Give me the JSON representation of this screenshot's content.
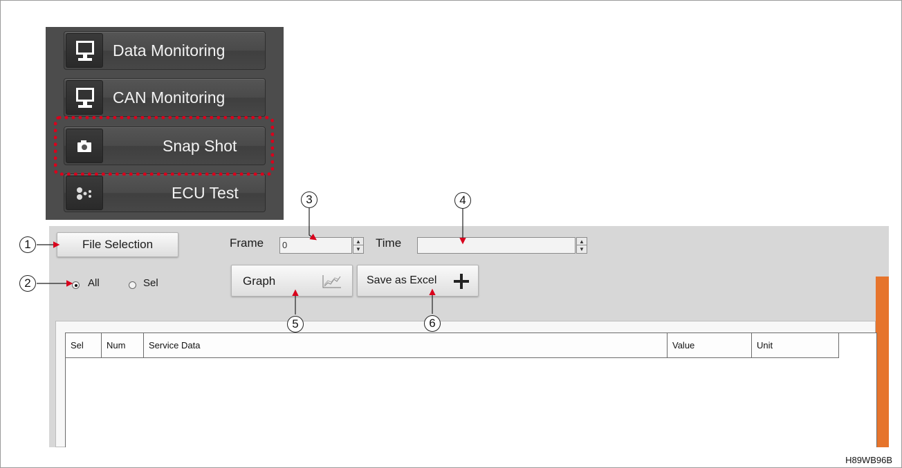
{
  "menu": {
    "items": [
      {
        "label": "Data Monitoring",
        "icon": "monitor-icon"
      },
      {
        "label": "CAN Monitoring",
        "icon": "monitor-icon"
      },
      {
        "label": "Snap Shot",
        "icon": "camera-icon"
      },
      {
        "label": "ECU Test",
        "icon": "ecu-icon"
      }
    ],
    "highlighted": "Snap Shot",
    "highlight_color": "#d9001c"
  },
  "toolbar": {
    "file_selection_label": "File Selection",
    "frame_label": "Frame",
    "frame_value": "0",
    "time_label": "Time",
    "time_value": "",
    "graph_label": "Graph",
    "save_excel_label": "Save as Excel"
  },
  "filter": {
    "all_label": "All",
    "sel_label": "Sel",
    "selected": "All"
  },
  "table": {
    "columns": [
      "Sel",
      "Num",
      "Service Data",
      "Value",
      "Unit"
    ],
    "rows": []
  },
  "callouts": [
    "1",
    "2",
    "3",
    "4",
    "5",
    "6"
  ],
  "footer": {
    "code": "H89WB96B"
  },
  "colors": {
    "accent": "#e6742c",
    "panel": "#4c4c4c",
    "app_bg": "#d7d7d7"
  }
}
